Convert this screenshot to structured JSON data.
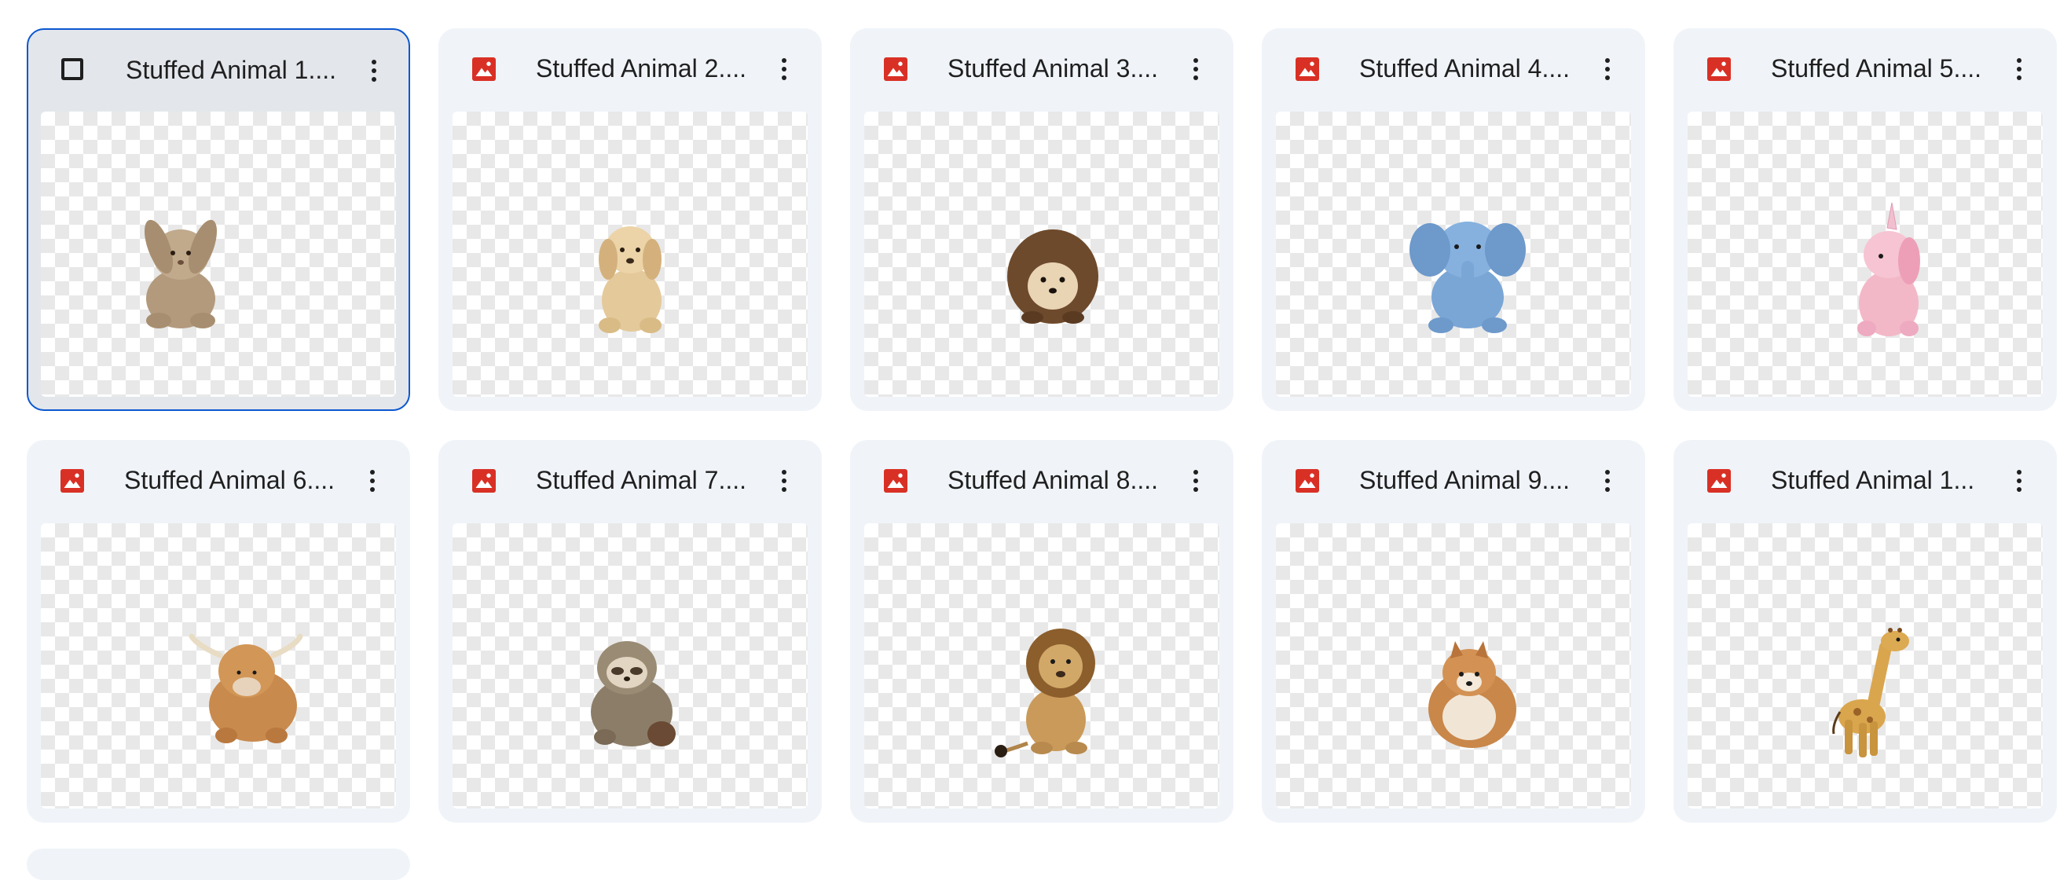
{
  "files": [
    {
      "title": "Stuffed Animal 1....",
      "animal_icon": "bunny-plush-thumbnail",
      "selected": true
    },
    {
      "title": "Stuffed Animal 2....",
      "animal_icon": "puppy-plush-thumbnail",
      "selected": false
    },
    {
      "title": "Stuffed Animal 3....",
      "animal_icon": "hedgehog-plush-thumbnail",
      "selected": false
    },
    {
      "title": "Stuffed Animal 4....",
      "animal_icon": "elephant-plush-thumbnail",
      "selected": false
    },
    {
      "title": "Stuffed Animal 5....",
      "animal_icon": "unicorn-plush-thumbnail",
      "selected": false
    },
    {
      "title": "Stuffed Animal 6....",
      "animal_icon": "highland-cow-plush-thumbnail",
      "selected": false
    },
    {
      "title": "Stuffed Animal 7....",
      "animal_icon": "sloth-plush-thumbnail",
      "selected": false
    },
    {
      "title": "Stuffed Animal 8....",
      "animal_icon": "lion-plush-thumbnail",
      "selected": false
    },
    {
      "title": "Stuffed Animal 9....",
      "animal_icon": "pomeranian-plush-thumbnail",
      "selected": false
    },
    {
      "title": "Stuffed Animal 1...",
      "animal_icon": "giraffe-plush-thumbnail",
      "selected": false
    }
  ],
  "colors": {
    "card_bg": "#f0f4f9",
    "selected_bg": "#e3e6eb",
    "selected_border": "#0b57d0",
    "image_icon_red": "#d93025",
    "text": "#1f1f1f"
  },
  "icons": {
    "file_type": "image-file-icon",
    "selection": "checkbox-icon",
    "menu": "more-vert-icon"
  }
}
